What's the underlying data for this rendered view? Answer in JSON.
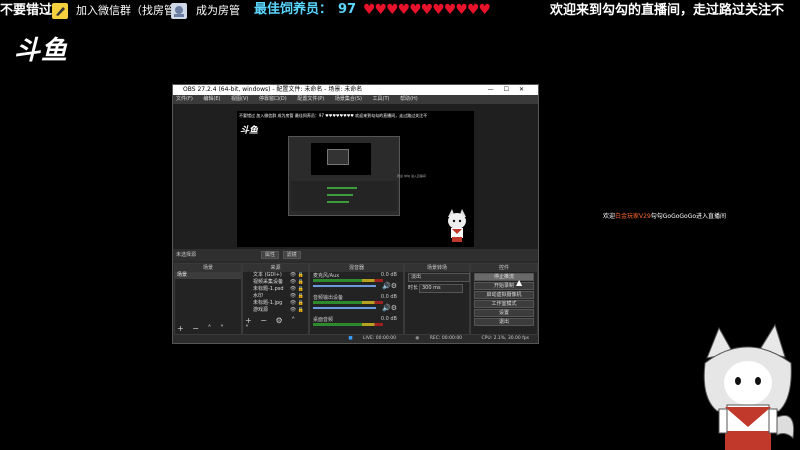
{
  "topbar": {
    "miss_text": "不要错过",
    "group_text": "加入微信群（找房管）",
    "admin_text": "成为房管",
    "fans_label": "最佳饲养员：",
    "fans_count": "97",
    "hearts": "♥♥♥♥♥♥♥♥♥♥♥",
    "welcome_text": "欢迎来到勾勾的直播间，走过路过关注不"
  },
  "logo_text": "斗鱼",
  "obs": {
    "title": "OBS 27.2.4 (64-bit, windows) - 配置文件: 未命名 - 场景: 未命名",
    "window_controls": "—☐✕",
    "menu": [
      "文件(F)",
      "编辑(E)",
      "视图(V)",
      "停靠窗口(D)",
      "配置文件(P)",
      "场景集合(S)",
      "工具(T)",
      "帮助(H)"
    ],
    "preview": {
      "top_text": "不要错过 加入微信群 成为房管   最佳饲养员：97 ♥♥♥♥♥♥♥♥  欢迎来到勾勾的直播间，走过路过关注不",
      "logo": "斗鱼",
      "chat": "欢迎 勾勾 进入直播间"
    },
    "status_label": "未选择源",
    "status_buttons": [
      "属性",
      "滤镜"
    ],
    "panels": {
      "scenes": {
        "title": "场景",
        "items": [
          "场景"
        ],
        "footer": "+ − ˄ ˅"
      },
      "sources": {
        "title": "来源",
        "items": [
          "文本 (GDI+)",
          "视频采集设备",
          "未标题-1.psd",
          "水印",
          "未标题-1.jpg",
          "游戏源"
        ],
        "footer": "+ − ⚙ ˄ ˅"
      },
      "mixer": {
        "title": "混音器",
        "channels": [
          {
            "name": "麦克风/Aux",
            "db": "0.0 dB"
          },
          {
            "name": "音频输出设备",
            "db": "0.0 dB"
          },
          {
            "name": "桌面音频",
            "db": "0.0 dB"
          }
        ]
      },
      "transitions": {
        "title": "场景转场",
        "type_value": "淡出",
        "duration_label": "时长",
        "duration_value": "300 ms"
      },
      "controls": {
        "title": "控件",
        "buttons": [
          "停止推流",
          "开始录制",
          "启动虚拟摄像机",
          "工作室模式",
          "设置",
          "退出"
        ]
      }
    },
    "statusbar": {
      "live": "LIVE: 00:00:00",
      "rec": "REC: 00:00:00",
      "cpu": "CPU: 2.1%, 30.00 fps"
    }
  },
  "chat_message": {
    "prefix": "欢迎",
    "name": "白金玩家V29",
    "suffix": "勾勾GoGoGoGo进入直播间"
  },
  "colors": {
    "fans_accent": "#5bd6ff",
    "heart": "#e8132a",
    "chat_name": "#ff6a2f"
  }
}
